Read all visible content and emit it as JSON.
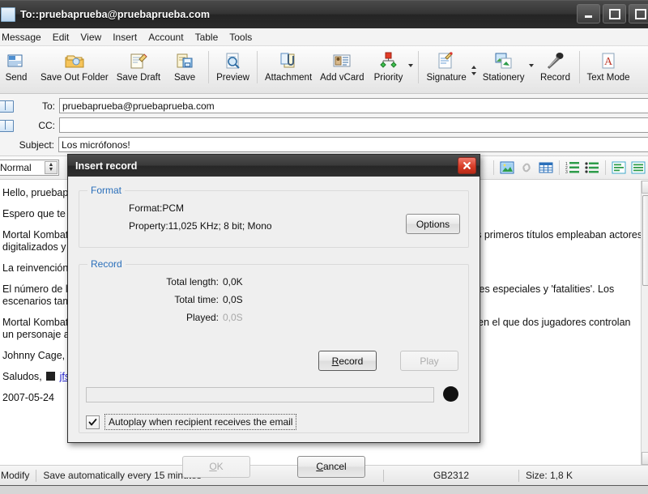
{
  "window": {
    "title": "To::pruebaprueba@pruebaprueba.com",
    "minimize_label": "Minimize",
    "maximize_label": "Maximize",
    "close_label": "Close"
  },
  "menu": {
    "items": [
      {
        "label": "Message"
      },
      {
        "label": "Edit"
      },
      {
        "label": "View"
      },
      {
        "label": "Insert"
      },
      {
        "label": "Account"
      },
      {
        "label": "Table"
      },
      {
        "label": "Tools"
      }
    ]
  },
  "toolbar": {
    "buttons": [
      {
        "label": "Send",
        "icon": "send-envelope-icon"
      },
      {
        "label": "Save Out Folder",
        "icon": "folder-icon"
      },
      {
        "label": "Save Draft",
        "icon": "draft-pencil-icon"
      },
      {
        "label": "Save",
        "icon": "floppy-disk-icon"
      },
      {
        "label": "Preview",
        "icon": "magnifier-page-icon"
      },
      {
        "label": "Attachment",
        "icon": "paperclip-icon"
      },
      {
        "label": "Add vCard",
        "icon": "contact-card-icon"
      },
      {
        "label": "Priority",
        "icon": "priority-tree-icon"
      },
      {
        "label": "Signature",
        "icon": "signature-page-icon"
      },
      {
        "label": "Stationery",
        "icon": "stationery-image-icon"
      },
      {
        "label": "Record",
        "icon": "microphone-icon"
      },
      {
        "label": "Text Mode",
        "icon": "text-mode-a-icon"
      }
    ]
  },
  "fields": {
    "to_label": "To:",
    "to_value": "pruebaprueba@pruebaprueba.com",
    "cc_label": "CC:",
    "cc_value": "",
    "subject_label": "Subject:",
    "subject_value": "Los micrófonos!"
  },
  "format_bar": {
    "style_value": "Normal",
    "buttons": [
      {
        "name": "insert-image-icon"
      },
      {
        "name": "insert-link-icon"
      },
      {
        "name": "insert-table-icon"
      },
      {
        "name": "numbered-list-icon"
      },
      {
        "name": "bulleted-list-icon"
      },
      {
        "name": "align-left-icon"
      },
      {
        "name": "align-justify-icon"
      }
    ]
  },
  "message_body": {
    "paragraphs": [
      "Hello, pruebaprueba",
      "Espero que te guste este correo.",
      "Mortal Kombat es una saga de videojuegos de lucha que se extiende desde 1992 hasta nuestros días. Los primeros títulos empleaban actores digitalizados y destacaron por su violencia y escenas de fin de combate llamadas vida.",
      "La reinvención de la saga llegó con Mortal Kombat: Deadly Alliance y su continuación y ampliación.",
      "El número de luchadores seleccionables creció con cada entrega, cada uno con sus propios combos, golpes especiales y 'fatalities'. Los escenarios también ganaron detalle y profundidad en cada ocasión.",
      "Mortal Kombat Armageddon reunió a casi todos los personajes de la serie y también dispone de un modo en el que dos jugadores controlan un personaje al mismo tiempo.",
      "Johnny Cage, Sonya Blade, Raiden, Sub-Zero, Scorpion, Liu Kang.",
      "Saludos, jfsuarez",
      "2007-05-24"
    ],
    "signature_link": "jfsuarez",
    "signature_prefix": "Saludos",
    "date": "2007-05-24"
  },
  "status_bar": {
    "mode": "Modify",
    "autosave": "Save automatically every 15 minutes",
    "encoding": "GB2312",
    "size": "Size: 1,8 K"
  },
  "dialog": {
    "title": "Insert record",
    "close_label": "Close",
    "format_group": {
      "legend": "Format",
      "format_line": "Format:PCM",
      "property_line": "Property:11,025 KHz; 8 bit; Mono",
      "options_button": "Options"
    },
    "record_group": {
      "legend": "Record",
      "total_length_label": "Total length:",
      "total_length_value": "0,0K",
      "total_time_label": "Total time:",
      "total_time_value": "0,0S",
      "played_label": "Played:",
      "played_value": "0,0S",
      "record_button": "Record",
      "play_button": "Play",
      "progress_percent": 0,
      "autoplay_label": "Autoplay when recipient receives the email",
      "autoplay_checked": true
    },
    "ok_button": "OK",
    "cancel_button": "Cancel"
  },
  "colors": {
    "legend_blue": "#2a6fba",
    "titlebar_dark": "#2d2d2d",
    "close_red": "#d83d28",
    "link_blue": "#2222cc"
  }
}
